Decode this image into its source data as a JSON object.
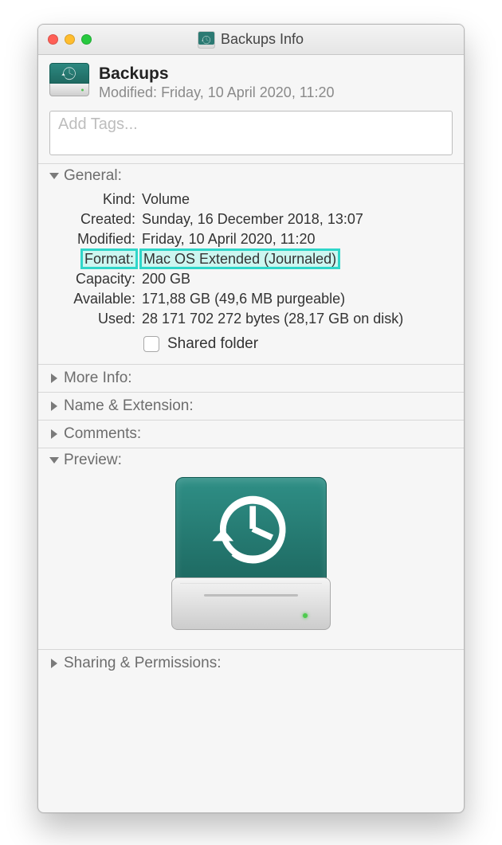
{
  "window": {
    "title": "Backups Info"
  },
  "header": {
    "name": "Backups",
    "modified_label": "Modified:",
    "modified_value": "Friday, 10 April 2020, 11:20"
  },
  "tags": {
    "placeholder": "Add Tags..."
  },
  "sections": {
    "general": {
      "title": "General:",
      "rows": {
        "kind": {
          "label": "Kind:",
          "value": "Volume"
        },
        "created": {
          "label": "Created:",
          "value": "Sunday, 16 December 2018, 13:07"
        },
        "modified": {
          "label": "Modified:",
          "value": "Friday, 10 April 2020, 11:20"
        },
        "format": {
          "label": "Format:",
          "value": "Mac OS Extended (Journaled)"
        },
        "capacity": {
          "label": "Capacity:",
          "value": "200 GB"
        },
        "available": {
          "label": "Available:",
          "value": "171,88 GB (49,6 MB purgeable)"
        },
        "used": {
          "label": "Used:",
          "value": "28 171 702 272 bytes (28,17 GB on disk)"
        }
      },
      "shared_folder_label": "Shared folder"
    },
    "more_info": {
      "title": "More Info:"
    },
    "name_ext": {
      "title": "Name & Extension:"
    },
    "comments": {
      "title": "Comments:"
    },
    "preview": {
      "title": "Preview:"
    },
    "sharing": {
      "title": "Sharing & Permissions:"
    }
  }
}
